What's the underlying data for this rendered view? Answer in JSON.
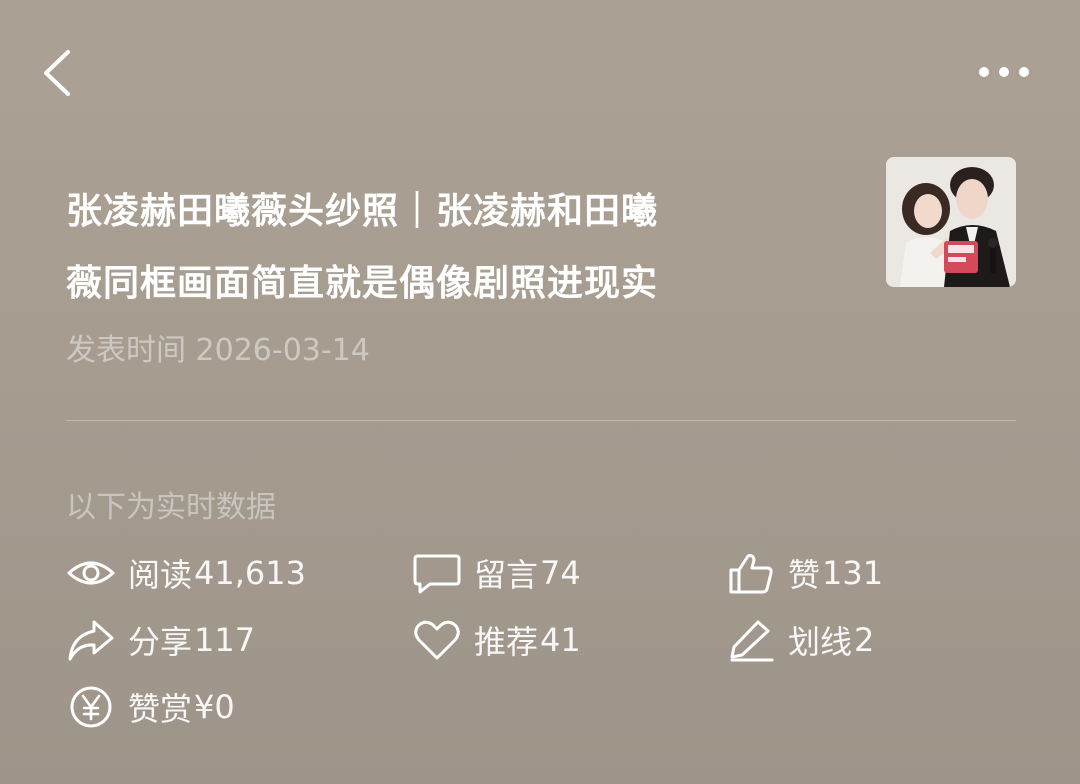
{
  "nav": {
    "back_icon": "chevron-left-icon",
    "more_icon": "more-dots-icon"
  },
  "article": {
    "title_line1": "张凌赫田曦薇头纱照｜张凌赫和田曦",
    "title_line2": "薇同框画面简直就是偶像剧照进现实",
    "publish_time": "发表时间 2026-03-14"
  },
  "stats_section": {
    "label": "以下为实时数据",
    "stats": [
      {
        "label": "阅读",
        "value": "41,613",
        "icon": "eye-icon"
      },
      {
        "label": "留言",
        "value": "74",
        "icon": "comment-icon"
      },
      {
        "label": "赞",
        "value": "131",
        "icon": "thumbs-up-icon"
      },
      {
        "label": "分享",
        "value": "117",
        "icon": "share-icon"
      },
      {
        "label": "推荐",
        "value": "41",
        "icon": "heart-icon"
      },
      {
        "label": "划线",
        "value": "2",
        "icon": "pen-icon"
      },
      {
        "label": "赞赏",
        "value": "¥0",
        "icon": "yen-icon"
      }
    ]
  },
  "colors": {
    "background": "#a69c90",
    "text": "#ffffff"
  }
}
